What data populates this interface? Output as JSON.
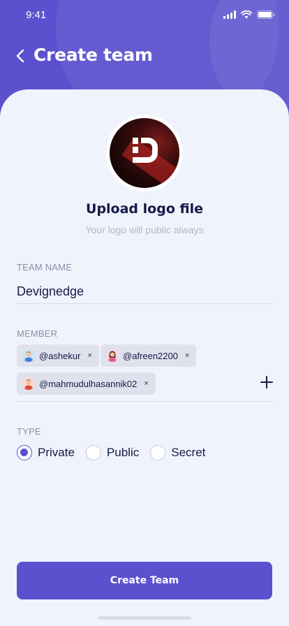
{
  "status": {
    "time": "9:41"
  },
  "nav": {
    "title": "Create team",
    "back_icon": "chevron-left-icon"
  },
  "logo": {
    "upload_title": "Upload logo file",
    "upload_subtitle": "Your logo will public always"
  },
  "team_name": {
    "label": "TEAM NAME",
    "value": "Devignedge"
  },
  "members": {
    "label": "MEMBER",
    "items": [
      {
        "handle": "@ashekur",
        "avatar": "male-avatar-icon"
      },
      {
        "handle": "@afreen2200",
        "avatar": "female-avatar-icon"
      },
      {
        "handle": "@mahmudulhasannik02",
        "avatar": "male-avatar-icon"
      }
    ],
    "remove_glyph": "×",
    "add_icon": "plus-icon"
  },
  "type": {
    "label": "TYPE",
    "options": [
      "Private",
      "Public",
      "Secret"
    ],
    "selected": "Private"
  },
  "actions": {
    "create_label": "Create Team"
  },
  "colors": {
    "accent": "#5B51CE",
    "background": "#F0F3FB",
    "text_dark": "#141A46",
    "text_muted": "#8A8FA8",
    "chip_bg": "#DFE2EC"
  }
}
